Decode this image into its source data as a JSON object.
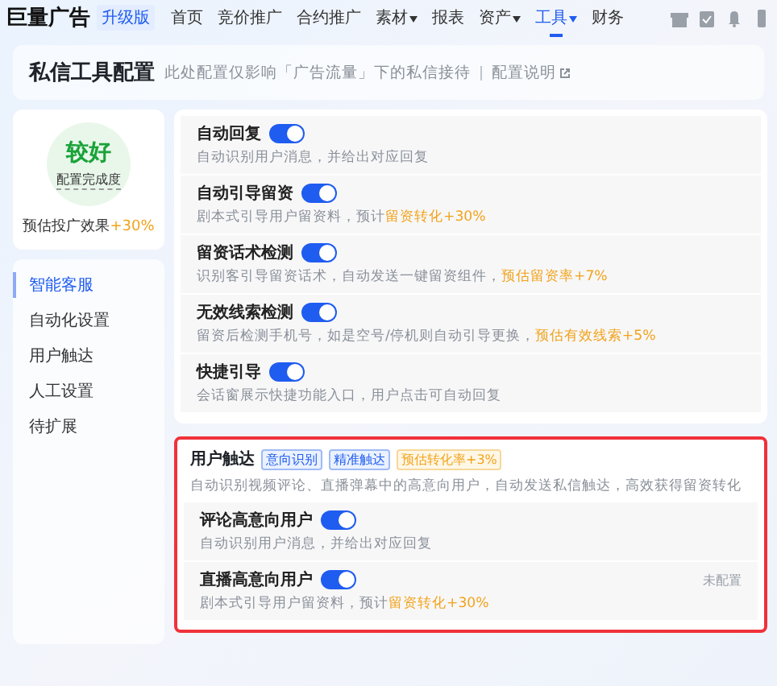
{
  "top_nav": {
    "logo": "巨量广告",
    "edition_badge": "升级版",
    "items": [
      {
        "label": "首页",
        "selected": false,
        "dropdown": false
      },
      {
        "label": "竞价推广",
        "selected": false,
        "dropdown": false
      },
      {
        "label": "合约推广",
        "selected": false,
        "dropdown": false
      },
      {
        "label": "素材",
        "selected": false,
        "dropdown": true
      },
      {
        "label": "报表",
        "selected": false,
        "dropdown": false
      },
      {
        "label": "资产",
        "selected": false,
        "dropdown": true
      },
      {
        "label": "工具",
        "selected": true,
        "dropdown": true
      },
      {
        "label": "财务",
        "selected": false,
        "dropdown": false
      }
    ]
  },
  "header": {
    "title": "私信工具配置",
    "description": "此处配置仅影响「广告流量」下的私信接待",
    "link": "配置说明"
  },
  "score_card": {
    "rating": "较好",
    "rating_caption": "配置完成度",
    "estimate_label": "预估投广效果",
    "estimate_value": "+30%"
  },
  "side_menu": [
    {
      "label": "智能客服",
      "selected": true
    },
    {
      "label": "自动化设置",
      "selected": false
    },
    {
      "label": "用户触达",
      "selected": false
    },
    {
      "label": "人工设置",
      "selected": false
    },
    {
      "label": "待扩展",
      "selected": false
    }
  ],
  "settings": [
    {
      "title": "自动回复",
      "on": true,
      "description": "自动识别用户消息，并给出对应回复"
    },
    {
      "title": "自动引导留资",
      "on": true,
      "description": "剧本式引导用户留资料，预计",
      "highlight": "留资转化+30%"
    },
    {
      "title": "留资话术检测",
      "on": true,
      "description": "识别客引导留资话术，自动发送一键留资组件，",
      "highlight": "预估留资率+7%"
    },
    {
      "title": "无效线索检测",
      "on": true,
      "description": "留资后检测手机号，如是空号/停机则自动引导更换，",
      "highlight": "预估有效线索+5%"
    },
    {
      "title": "快捷引导",
      "on": true,
      "description": "会话窗展示快捷功能入口，用户点击可自动回复"
    }
  ],
  "user_reach": {
    "title": "用户触达",
    "tags": [
      {
        "label": "意向识别",
        "kind": "info"
      },
      {
        "label": "精准触达",
        "kind": "info"
      },
      {
        "label": "预估转化率+3%",
        "kind": "warning"
      }
    ],
    "description": "自动识别视频评论、直播弹幕中的高意向用户，自动发送私信触达，高效获得留资转化",
    "items": [
      {
        "title": "评论高意向用户",
        "on": true,
        "description": "自动识别用户消息，并给出对应回复"
      },
      {
        "title": "直播高意向用户",
        "on": true,
        "description": "剧本式引导用户留资料，预计",
        "highlight": "留资转化+30%",
        "status": "未配置"
      }
    ]
  }
}
